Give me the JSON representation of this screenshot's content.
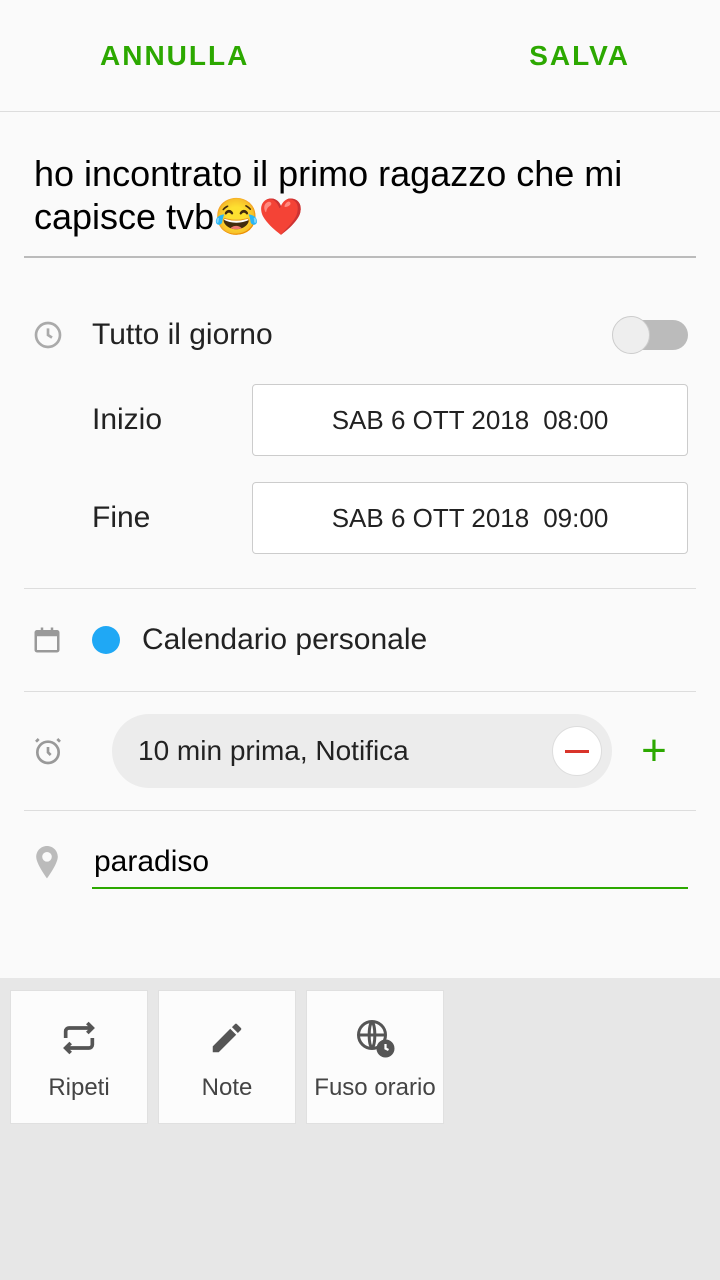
{
  "header": {
    "cancel": "ANNULLA",
    "save": "SALVA"
  },
  "title": "ho incontrato il primo ragazzo che mi capisce tvb😂❤️",
  "allday": {
    "label": "Tutto il giorno",
    "enabled": false
  },
  "start": {
    "label": "Inizio",
    "date": "SAB 6 OTT 2018",
    "time": "08:00"
  },
  "end": {
    "label": "Fine",
    "date": "SAB 6 OTT 2018",
    "time": "09:00"
  },
  "calendar": {
    "name": "Calendario personale",
    "color": "#1fa8f5"
  },
  "reminder": {
    "text": "10 min prima, Notifica"
  },
  "location": {
    "value": "paradiso"
  },
  "bottom": {
    "repeat": "Ripeti",
    "notes": "Note",
    "timezone": "Fuso orario"
  }
}
